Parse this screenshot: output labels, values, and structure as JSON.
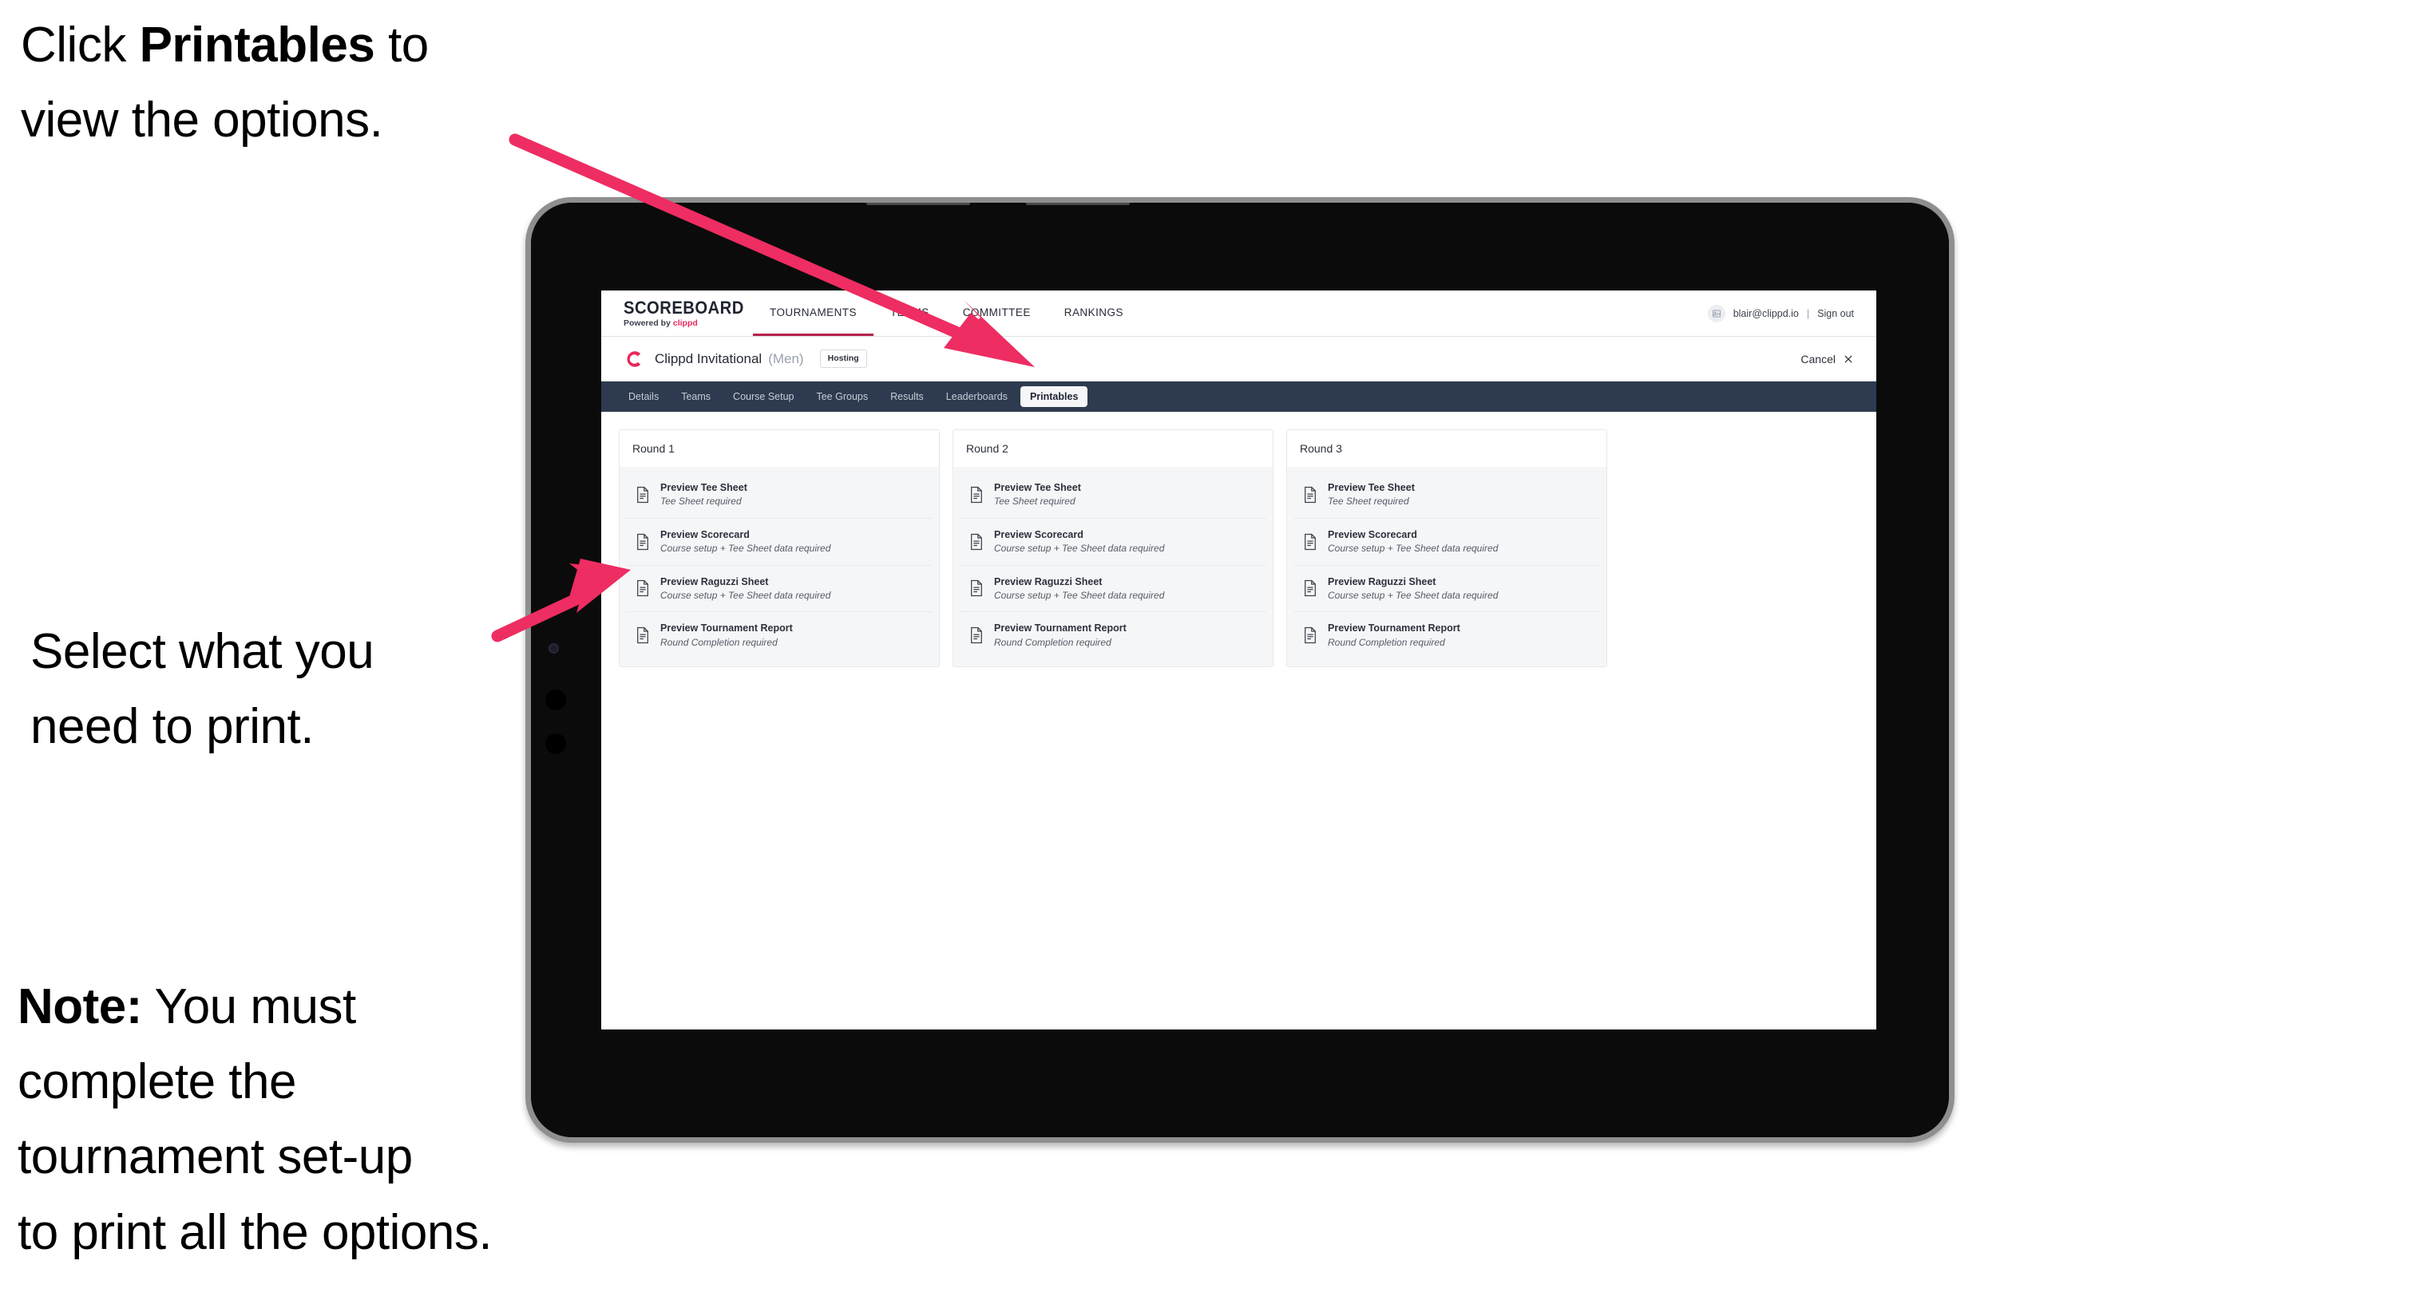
{
  "annotations": {
    "printables_callout": {
      "pre": "Click ",
      "bold": "Printables",
      "post": " to\nview the options."
    },
    "select_callout": {
      "text": "Select what you\n need to print."
    },
    "note_callout": {
      "bold": "Note:",
      "text": " You must\ncomplete the\ntournament set-up\nto print all the options."
    }
  },
  "colors": {
    "arrow_pink": "#ee2d62",
    "tabstrip_navy": "#2e3a4f",
    "brand_accent": "#e8275a",
    "active_nav_underline": "#b5224a"
  },
  "app": {
    "brand": {
      "title": "SCOREBOARD",
      "powered_by_prefix": "Powered by ",
      "powered_by_brand": "clippd"
    },
    "main_nav": [
      {
        "label": "TOURNAMENTS",
        "active": true
      },
      {
        "label": "TEAMS",
        "active": false
      },
      {
        "label": "COMMITTEE",
        "active": false
      },
      {
        "label": "RANKINGS",
        "active": false
      }
    ],
    "account": {
      "avatar_icon": "user-image-icon",
      "email": "blair@clippd.io",
      "separator": "|",
      "sign_out_label": "Sign out"
    },
    "tournament": {
      "logo_icon": "clippd-c-logo-icon",
      "name": "Clippd Invitational",
      "gender": "(Men)",
      "status_badge": "Hosting",
      "cancel_label": "Cancel",
      "cancel_icon": "close-x-icon"
    },
    "tabs": [
      {
        "label": "Details",
        "active": false
      },
      {
        "label": "Teams",
        "active": false
      },
      {
        "label": "Course Setup",
        "active": false
      },
      {
        "label": "Tee Groups",
        "active": false
      },
      {
        "label": "Results",
        "active": false
      },
      {
        "label": "Leaderboards",
        "active": false
      },
      {
        "label": "Printables",
        "active": true
      }
    ],
    "rounds": [
      {
        "header": "Round 1",
        "items": [
          {
            "title": "Preview Tee Sheet",
            "requirement": "Tee Sheet required",
            "icon": "document-icon"
          },
          {
            "title": "Preview Scorecard",
            "requirement": "Course setup + Tee Sheet data required",
            "icon": "document-icon"
          },
          {
            "title": "Preview Raguzzi Sheet",
            "requirement": "Course setup + Tee Sheet data required",
            "icon": "document-icon"
          },
          {
            "title": "Preview Tournament Report",
            "requirement": "Round Completion required",
            "icon": "document-icon"
          }
        ]
      },
      {
        "header": "Round 2",
        "items": [
          {
            "title": "Preview Tee Sheet",
            "requirement": "Tee Sheet required",
            "icon": "document-icon"
          },
          {
            "title": "Preview Scorecard",
            "requirement": "Course setup + Tee Sheet data required",
            "icon": "document-icon"
          },
          {
            "title": "Preview Raguzzi Sheet",
            "requirement": "Course setup + Tee Sheet data required",
            "icon": "document-icon"
          },
          {
            "title": "Preview Tournament Report",
            "requirement": "Round Completion required",
            "icon": "document-icon"
          }
        ]
      },
      {
        "header": "Round 3",
        "items": [
          {
            "title": "Preview Tee Sheet",
            "requirement": "Tee Sheet required",
            "icon": "document-icon"
          },
          {
            "title": "Preview Scorecard",
            "requirement": "Course setup + Tee Sheet data required",
            "icon": "document-icon"
          },
          {
            "title": "Preview Raguzzi Sheet",
            "requirement": "Course setup + Tee Sheet data required",
            "icon": "document-icon"
          },
          {
            "title": "Preview Tournament Report",
            "requirement": "Round Completion required",
            "icon": "document-icon"
          }
        ]
      }
    ]
  }
}
